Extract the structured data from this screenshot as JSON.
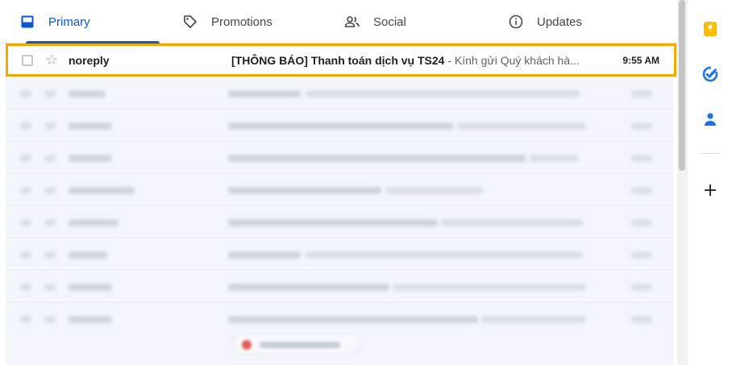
{
  "tabs": [
    {
      "label": "Primary",
      "icon": "inbox-icon",
      "active": true
    },
    {
      "label": "Promotions",
      "icon": "tag-icon",
      "active": false
    },
    {
      "label": "Social",
      "icon": "people-icon",
      "active": false
    },
    {
      "label": "Updates",
      "icon": "info-icon",
      "active": false
    }
  ],
  "highlighted_email": {
    "sender": "noreply",
    "subject": "[THÔNG BÁO] Thanh toán dịch vụ TS24",
    "snippet": " - Kính gửi Quý khách hà...",
    "time": "9:55 AM"
  },
  "colors": {
    "accent": "#0b57d0",
    "highlight_border": "#f2a900",
    "keep": "#fbbc04",
    "tasks": "#1a73e8",
    "contacts": "#1a73e8"
  },
  "right_rail": [
    "keep-icon",
    "tasks-icon",
    "contacts-icon",
    "add-icon"
  ]
}
